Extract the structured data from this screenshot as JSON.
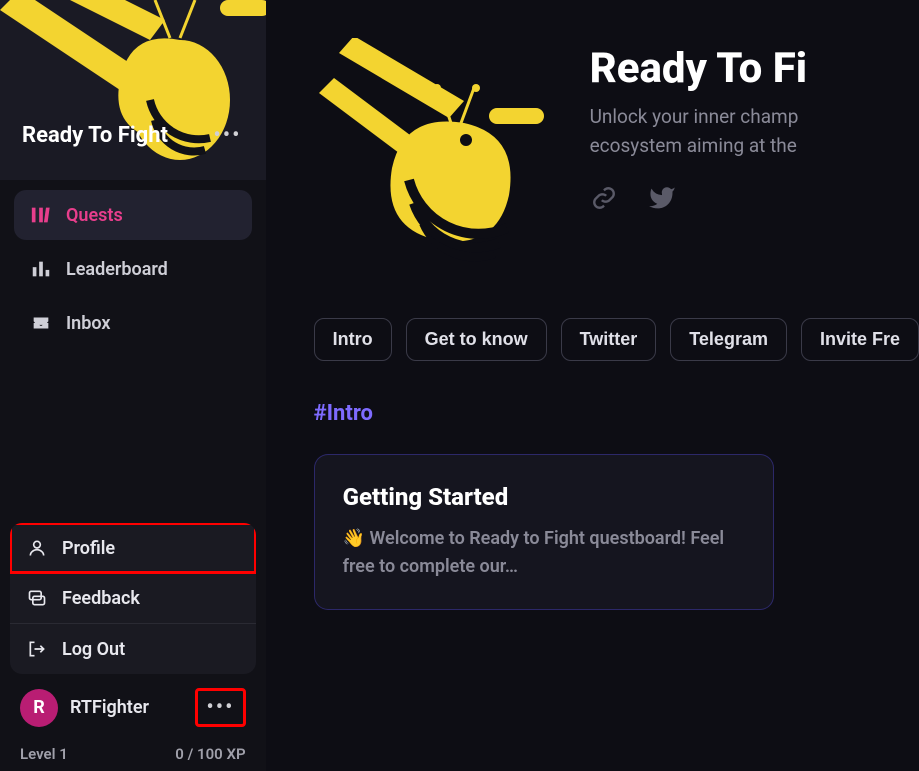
{
  "sidebar": {
    "title": "Ready To Fight",
    "nav": [
      {
        "label": "Quests",
        "active": true
      },
      {
        "label": "Leaderboard",
        "active": false
      },
      {
        "label": "Inbox",
        "active": false
      }
    ],
    "user_menu": {
      "profile": "Profile",
      "feedback": "Feedback",
      "logout": "Log Out"
    },
    "user": {
      "initial": "R",
      "name": "RTFighter",
      "level": "Level 1",
      "xp": "0 / 100 XP"
    }
  },
  "main": {
    "title": "Ready To Fi",
    "subtitle_line1": "Unlock your inner champ",
    "subtitle_line2": "ecosystem aiming at the",
    "tags": [
      "Intro",
      "Get to know",
      "Twitter",
      "Telegram",
      "Invite Fre"
    ],
    "section_hash": "#Intro",
    "card": {
      "title": "Getting Started",
      "body": "👋 Welcome to Ready to Fight questboard! Feel free to complete our…"
    }
  }
}
